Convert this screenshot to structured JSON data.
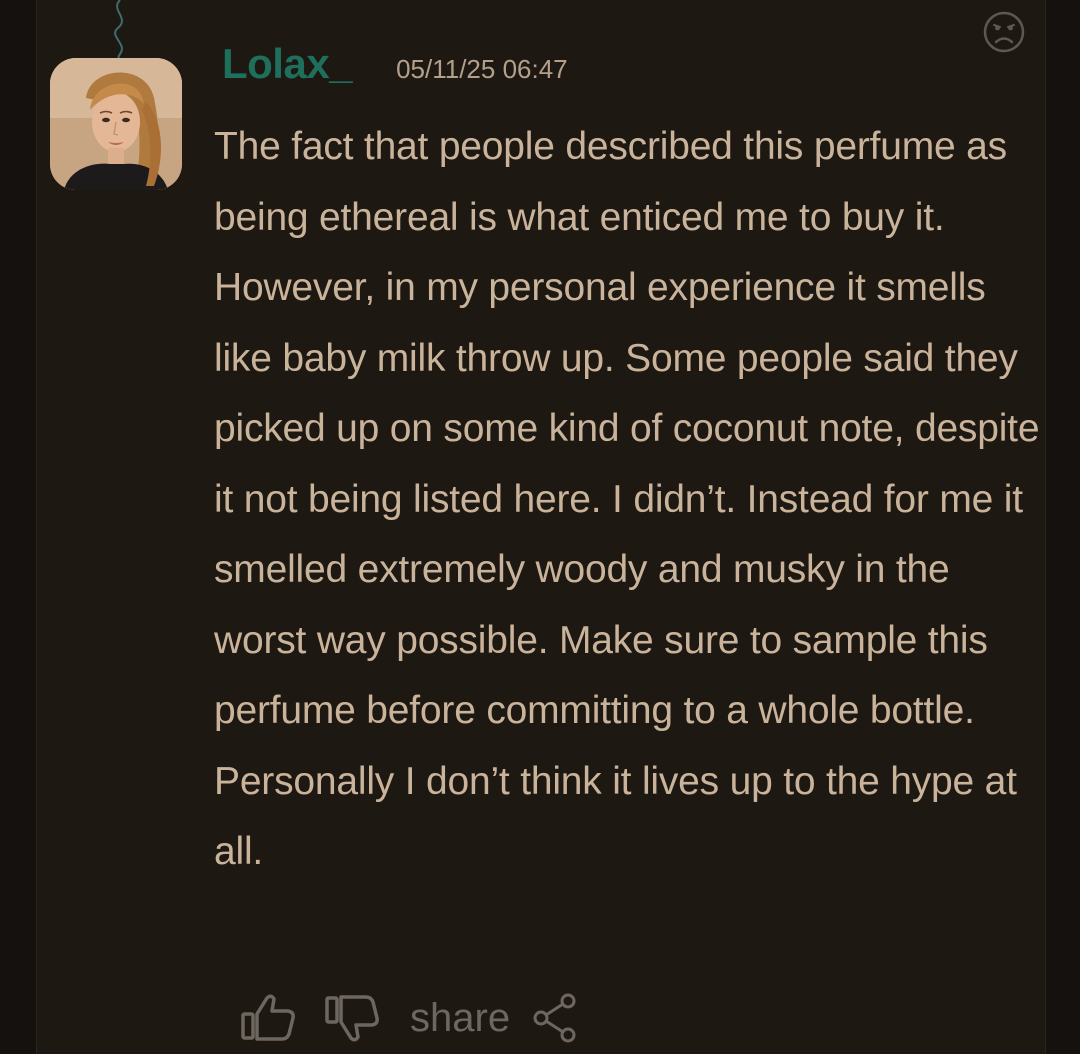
{
  "comment": {
    "username": "Lolax_",
    "timestamp": "05/11/25 06:47",
    "body": "The fact that people described this perfume as being ethereal is what enticed me to buy it. However, in my personal experience it smells like baby milk throw up. Some people said they picked up on some kind of coconut note, despite it not being listed here. I didn’t. Instead for me it smelled extremely woody and musky in the worst way possible. Make sure to sample this perfume before committing to a whole bottle. Personally I don’t think it lives up to the hype at all.",
    "mood_icon": "frown-face-icon"
  },
  "actions": {
    "like_icon": "thumbs-up-icon",
    "dislike_icon": "thumbs-down-icon",
    "share_label": "share",
    "share_icon": "share-icon"
  },
  "colors": {
    "background": "#14110e",
    "card": "#1e1813",
    "username": "#1f6f5d",
    "text": "#c9b39a",
    "muted": "#6e6760"
  }
}
